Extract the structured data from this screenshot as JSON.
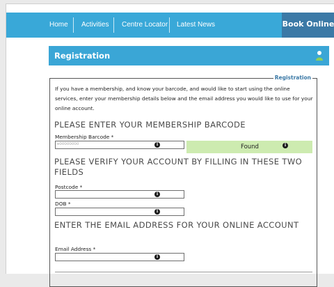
{
  "nav": {
    "items": [
      "Home",
      "Activities",
      "Centre Locator",
      "Latest News"
    ],
    "book_online": "Book Online"
  },
  "registration": {
    "header_title": "Registration",
    "legend": "Registration",
    "intro": "If you have a membership, and know your barcode, and would like to start using the online services, enter your membership details below and the email address you would like to use for your online account.",
    "heading_barcode": "PLEASE ENTER YOUR MEMBERSHIP BARCODE",
    "barcode_label": "Membership Barcode *",
    "barcode_placeholder": "e00000000",
    "found_text": "Found",
    "heading_verify": "PLEASE VERIFY YOUR ACCOUNT BY FILLING IN THESE TWO FIELDS",
    "postcode_label": "Postcode *",
    "dob_label": "DOB *",
    "heading_email": "ENTER THE EMAIL ADDRESS FOR YOUR ONLINE ACCOUNT",
    "email_label": "Email Address *"
  },
  "icons": {
    "info": "info-icon",
    "user": "user-icon"
  },
  "colors": {
    "nav_bg": "#39a8d8",
    "book_online_bg": "#3b79a6",
    "found_bg": "#cdebb0",
    "heading_text": "#4a4a4a"
  }
}
